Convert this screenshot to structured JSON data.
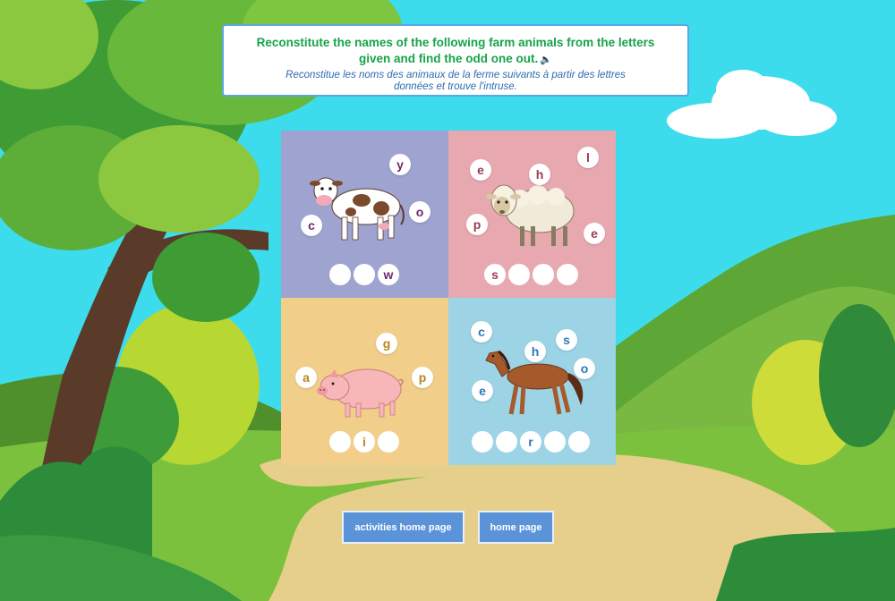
{
  "instruction": {
    "en": "Reconstitute the names of the following farm animals from the letters given and find the odd one out.",
    "fr": "Reconstitue les noms des animaux de la ferme suivants à partir des lettres données et trouve l'intruse."
  },
  "cards": [
    {
      "animal": "cow",
      "letters": [
        "y",
        "c",
        "o"
      ],
      "slots": [
        "",
        "",
        "w"
      ]
    },
    {
      "animal": "sheep",
      "letters": [
        "e",
        "h",
        "l",
        "p",
        "e"
      ],
      "slots": [
        "s",
        "",
        "",
        ""
      ]
    },
    {
      "animal": "pig",
      "letters": [
        "g",
        "a",
        "p"
      ],
      "slots": [
        "",
        "i",
        ""
      ]
    },
    {
      "animal": "horse",
      "letters": [
        "c",
        "h",
        "s",
        "o",
        "e"
      ],
      "slots": [
        "",
        "",
        "r",
        "",
        ""
      ]
    }
  ],
  "buttons": {
    "activities_home": "activities home page",
    "home": "home page"
  },
  "icons": {
    "speaker": "speaker-icon"
  }
}
